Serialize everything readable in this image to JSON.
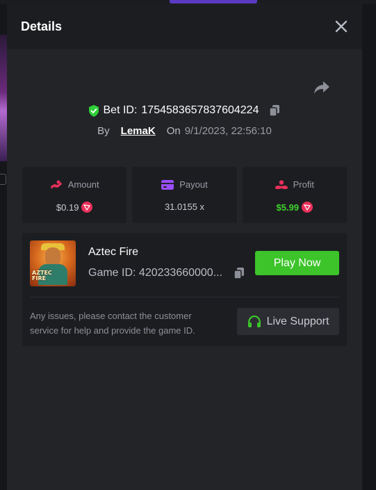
{
  "modal": {
    "title": "Details"
  },
  "bet": {
    "label": "Bet ID:",
    "id": "1754583657837604224",
    "by_label": "By",
    "user": "LemaK",
    "on_label": "On",
    "datetime": "9/1/2023, 22:56:10"
  },
  "stats": [
    {
      "label": "Amount",
      "value": "$0.19",
      "icon": "amount-icon",
      "currency_icon": "trx-icon",
      "color": "#e8305a"
    },
    {
      "label": "Payout",
      "value": "31.0155 x",
      "icon": "wallet-card-icon",
      "color": "#9b4dff"
    },
    {
      "label": "Profit",
      "value": "$5.99",
      "icon": "profit-icon",
      "currency_icon": "trx-icon",
      "color": "#e8305a",
      "value_color": "#3fd32a"
    }
  ],
  "game": {
    "name": "Aztec Fire",
    "id_label": "Game ID:",
    "id_value": "420233660000...",
    "thumb_text_line1": "AZTEC",
    "thumb_text_line2": "FIRE",
    "play_label": "Play Now",
    "issue_text": "Any issues, please contact the customer service for help and provide the game ID.",
    "support_label": "Live Support"
  },
  "colors": {
    "accent_green": "#3cc42a",
    "profit_green": "#3fd32a",
    "shield_green": "#2fcf38",
    "trx_red": "#e8305a",
    "payout_purple": "#9b4dff"
  }
}
